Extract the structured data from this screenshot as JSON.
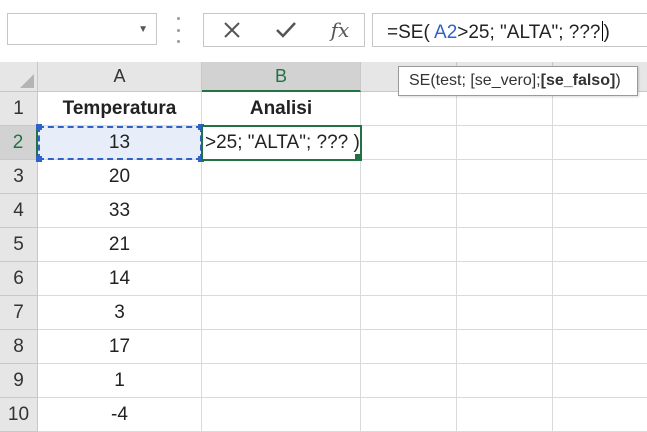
{
  "formula_bar": {
    "name_box": "",
    "cancel_icon": "close-icon",
    "enter_icon": "check-icon",
    "fx_label": "fx",
    "formula_prefix": "=SE(",
    "formula_ref": "A2",
    "formula_rest": ">25; \"ALTA\"; ???",
    "formula_end": ")"
  },
  "tooltip": {
    "prefix": "SE(test; [se_vero]; ",
    "bold_arg": "[se_falso]",
    "suffix": ")"
  },
  "columns": [
    "A",
    "B"
  ],
  "rows": [
    "1",
    "2",
    "3",
    "4",
    "5",
    "6",
    "7",
    "8",
    "9",
    "10"
  ],
  "cells": {
    "A1": "Temperatura",
    "B1": "Analisi",
    "A2": "13",
    "B2": ">25; \"ALTA\"; ??? )",
    "A3": "20",
    "A4": "33",
    "A5": "21",
    "A6": "14",
    "A7": "3",
    "A8": "17",
    "A9": "1",
    "A10": "-4"
  },
  "colors": {
    "accent_green": "#217346",
    "ref_blue": "#2f62c8"
  }
}
